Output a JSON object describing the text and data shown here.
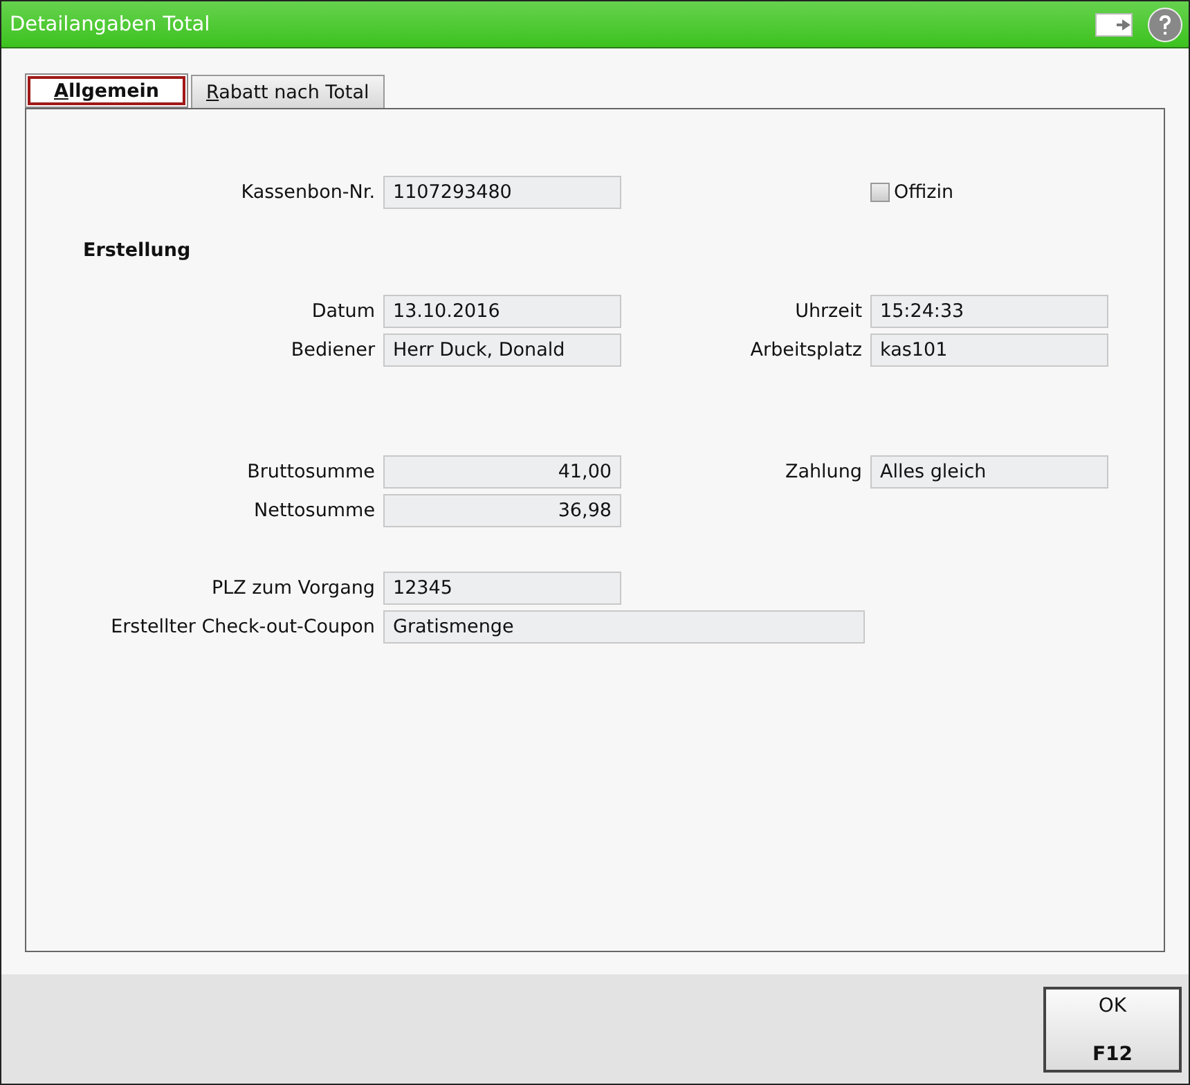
{
  "window": {
    "title": "Detailangaben Total"
  },
  "tabs": [
    {
      "label": "Allgemein",
      "selected": true
    },
    {
      "label": "Rabatt nach Total",
      "selected": false
    }
  ],
  "groups": [
    {
      "rows": [
        {
          "left": {
            "kind": "text",
            "label": "Kassenbon-Nr.",
            "value": "1107293480"
          },
          "right": {
            "kind": "checkbox",
            "label": "Offizin",
            "checked": false
          }
        }
      ]
    },
    {
      "heading": "Erstellung",
      "rows": [
        {
          "left": {
            "kind": "text",
            "label": "Datum",
            "value": "13.10.2016"
          },
          "right": {
            "kind": "text",
            "label": "Uhrzeit",
            "value": "15:24:33"
          }
        },
        {
          "left": {
            "kind": "text",
            "label": "Bediener",
            "value": "Herr Duck, Donald"
          },
          "right": {
            "kind": "text",
            "label": "Arbeitsplatz",
            "value": "kas101"
          }
        }
      ]
    },
    {
      "rows": [
        {
          "left": {
            "kind": "amount",
            "label": "Bruttosumme",
            "value": "41,00"
          },
          "right": {
            "kind": "text",
            "label": "Zahlung",
            "value": "Alles gleich"
          }
        },
        {
          "left": {
            "kind": "amount",
            "label": "Nettosumme",
            "value": "36,98"
          }
        }
      ]
    },
    {
      "rows": [
        {
          "left": {
            "kind": "text",
            "label": "PLZ zum Vorgang",
            "value": "12345"
          }
        },
        {
          "left": {
            "kind": "wide",
            "label": "Erstellter Check-out-Coupon",
            "value": "Gratismenge"
          }
        }
      ]
    }
  ],
  "ok_button": {
    "label": "OK",
    "shortcut": "F12"
  }
}
